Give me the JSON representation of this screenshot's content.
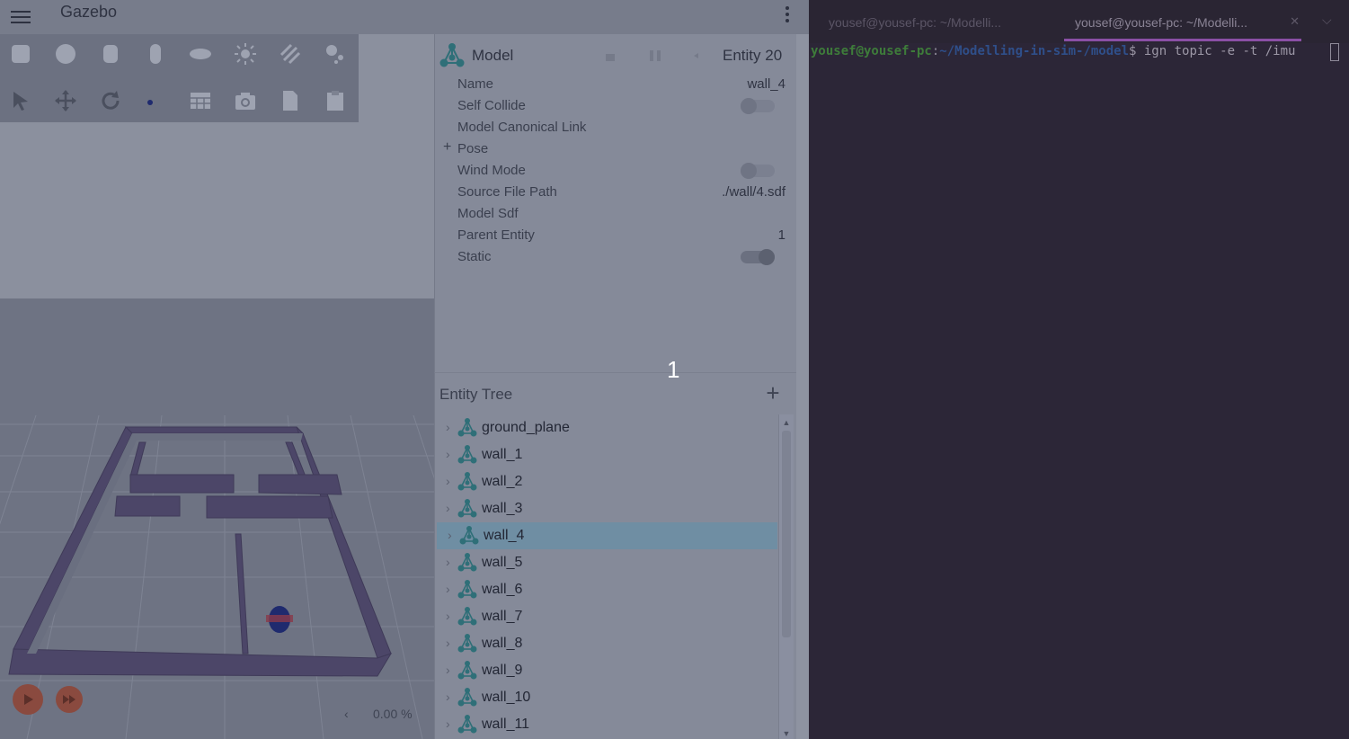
{
  "gazebo": {
    "window_title": "Gazebo",
    "inspector": {
      "title": "Model",
      "entity_label": "Entity 20",
      "properties": {
        "name": {
          "label": "Name",
          "value": "wall_4"
        },
        "self_collide": {
          "label": "Self Collide",
          "state": false
        },
        "canonical_link": {
          "label": "Model Canonical Link"
        },
        "pose": {
          "label": "Pose",
          "expander": "+"
        },
        "wind_mode": {
          "label": "Wind Mode",
          "state": false
        },
        "source_file": {
          "label": "Source File Path",
          "value": "./wall/4.sdf"
        },
        "model_sdf": {
          "label": "Model Sdf"
        },
        "parent_entity": {
          "label": "Parent Entity",
          "value": "1"
        },
        "static": {
          "label": "Static",
          "state": true
        }
      }
    },
    "tree": {
      "title": "Entity Tree",
      "add_label": "+",
      "items": [
        "ground_plane",
        "wall_1",
        "wall_2",
        "wall_3",
        "wall_4",
        "wall_5",
        "wall_6",
        "wall_7",
        "wall_8",
        "wall_9",
        "wall_10",
        "wall_11"
      ],
      "selected": "wall_4"
    },
    "rtf": "0.00 %",
    "overlay_number": "1"
  },
  "terminal": {
    "tabs": [
      "yousef@yousef-pc: ~/Modelli...",
      "yousef@yousef-pc: ~/Modelli..."
    ],
    "active_tab": 1,
    "prompt_user": "yousef@yousef-pc",
    "prompt_path": "~/Modelling-in-sim-/model",
    "prompt_dollar": "$ ",
    "command": "ign topic -e -t /imu"
  },
  "colors": {
    "selection": "#6f8ea3",
    "play_button": "#8a4a3f",
    "terminal_bg": "#2c2637",
    "tab_accent": "#8a4fa5"
  }
}
